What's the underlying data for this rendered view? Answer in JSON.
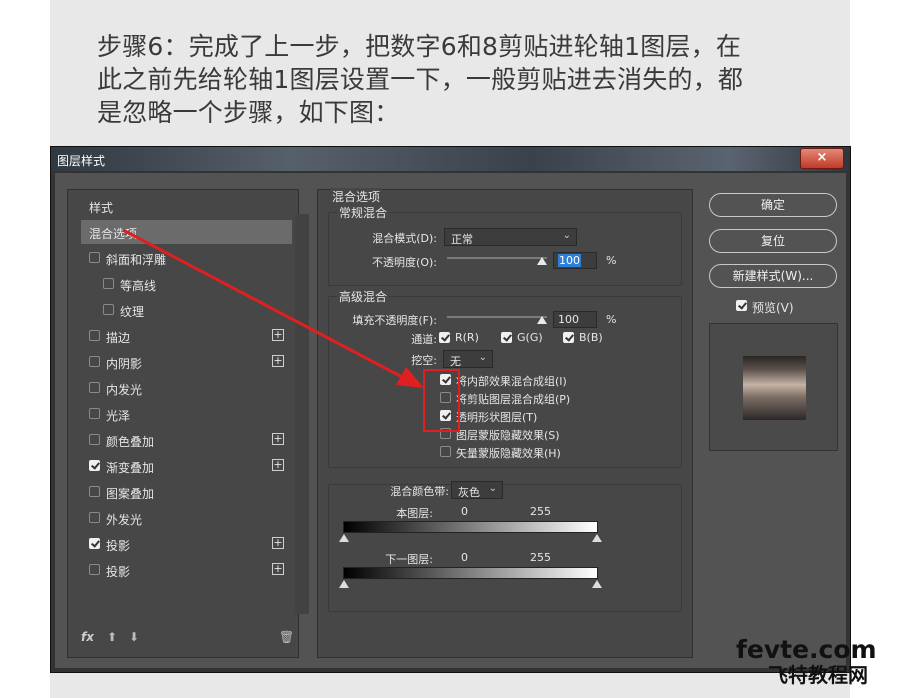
{
  "tutorial": {
    "lines": [
      "步骤6：完成了上一步，把数字6和8剪贴进轮轴1图层，在",
      "此之前先给轮轴1图层设置一下，一般剪贴进去消失的，都",
      "是忽略一个步骤，如下图："
    ]
  },
  "dialog": {
    "title": "图层样式",
    "close": "×",
    "styles_panel": {
      "header": "样式",
      "items": [
        {
          "label": "混合选项",
          "checkbox": false,
          "checked": false,
          "selected": true,
          "plus": false,
          "indent": false
        },
        {
          "label": "斜面和浮雕",
          "checkbox": true,
          "checked": false,
          "selected": false,
          "plus": false,
          "indent": false
        },
        {
          "label": "等高线",
          "checkbox": true,
          "checked": false,
          "selected": false,
          "plus": false,
          "indent": true
        },
        {
          "label": "纹理",
          "checkbox": true,
          "checked": false,
          "selected": false,
          "plus": false,
          "indent": true
        },
        {
          "label": "描边",
          "checkbox": true,
          "checked": false,
          "selected": false,
          "plus": true,
          "indent": false
        },
        {
          "label": "内阴影",
          "checkbox": true,
          "checked": false,
          "selected": false,
          "plus": true,
          "indent": false
        },
        {
          "label": "内发光",
          "checkbox": true,
          "checked": false,
          "selected": false,
          "plus": false,
          "indent": false
        },
        {
          "label": "光泽",
          "checkbox": true,
          "checked": false,
          "selected": false,
          "plus": false,
          "indent": false
        },
        {
          "label": "颜色叠加",
          "checkbox": true,
          "checked": false,
          "selected": false,
          "plus": true,
          "indent": false
        },
        {
          "label": "渐变叠加",
          "checkbox": true,
          "checked": true,
          "selected": false,
          "plus": true,
          "indent": false
        },
        {
          "label": "图案叠加",
          "checkbox": true,
          "checked": false,
          "selected": false,
          "plus": false,
          "indent": false
        },
        {
          "label": "外发光",
          "checkbox": true,
          "checked": false,
          "selected": false,
          "plus": false,
          "indent": false
        },
        {
          "label": "投影",
          "checkbox": true,
          "checked": true,
          "selected": false,
          "plus": true,
          "indent": false
        },
        {
          "label": "投影",
          "checkbox": true,
          "checked": false,
          "selected": false,
          "plus": true,
          "indent": false
        }
      ],
      "fx": "fx"
    },
    "blending": {
      "title": "混合选项",
      "general": {
        "title": "常规混合",
        "mode_label": "混合模式(D):",
        "mode_value": "正常",
        "opacity_label": "不透明度(O):",
        "opacity_value": "100",
        "opacity_fraction": 1.0,
        "unit": "%"
      },
      "advanced": {
        "title": "高级混合",
        "fill_label": "填充不透明度(F):",
        "fill_value": "100",
        "fill_fraction": 1.0,
        "unit": "%",
        "channels_label": "通道:",
        "channels": [
          {
            "label": "R(R)",
            "checked": true
          },
          {
            "label": "G(G)",
            "checked": true
          },
          {
            "label": "B(B)",
            "checked": true
          }
        ],
        "knockout_label": "挖空:",
        "knockout_value": "无",
        "options": [
          {
            "label": "将内部效果混合成组(I)",
            "checked": true
          },
          {
            "label": "将剪贴图层混合成组(P)",
            "checked": false
          },
          {
            "label": "透明形状图层(T)",
            "checked": true
          },
          {
            "label": "图层蒙版隐藏效果(S)",
            "checked": false
          },
          {
            "label": "矢量蒙版隐藏效果(H)",
            "checked": false
          }
        ]
      },
      "blend_if": {
        "label": "混合颜色带:",
        "value": "灰色",
        "this_layer_label": "本图层:",
        "this_layer_min": "0",
        "this_layer_max": "255",
        "underlying_label": "下一图层:",
        "underlying_min": "0",
        "underlying_max": "255"
      }
    },
    "buttons": {
      "ok": "确定",
      "reset": "复位",
      "new_style": "新建样式(W)...",
      "preview_label": "预览(V)",
      "preview_checked": true
    }
  },
  "watermark": {
    "line1": "fevte.com",
    "line2": "飞特教程网"
  },
  "colors": {
    "annotation_red": "#e02020",
    "dialog_bg": "#535353",
    "highlight": "#2f7fd6"
  }
}
